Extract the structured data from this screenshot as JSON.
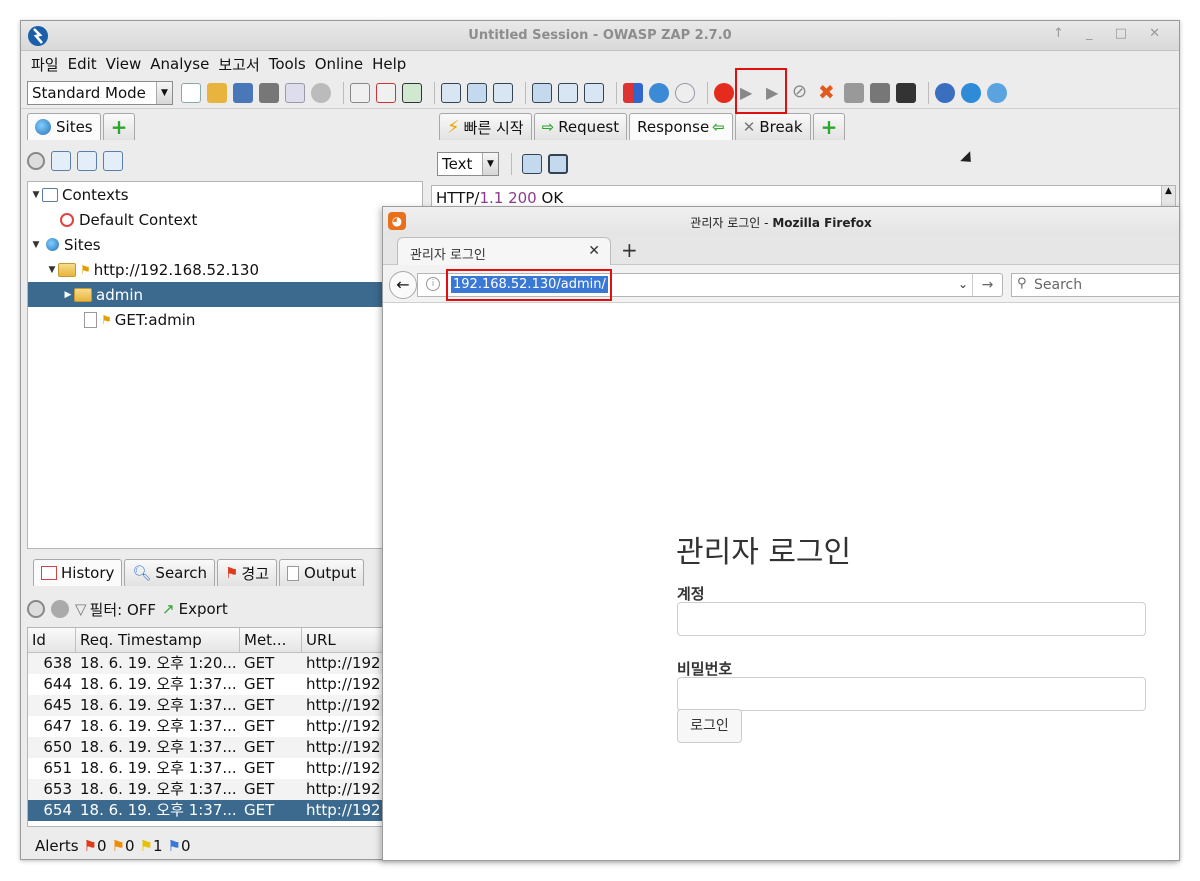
{
  "zap": {
    "title": "Untitled Session - OWASP ZAP 2.7.0",
    "window_controls": "↑ _ □ ✕",
    "menu": [
      "파일",
      "Edit",
      "View",
      "Analyse",
      "보고서",
      "Tools",
      "Online",
      "Help"
    ],
    "mode": "Standard Mode",
    "left_tabs": {
      "sites": "Sites"
    },
    "right_tabs": {
      "quick_start": "빠른 시작",
      "request": "Request",
      "response": "Response",
      "break": "Break"
    },
    "response_view": {
      "mode": "Text",
      "status_prefix": "HTTP/",
      "version": "1.1",
      "code": "200",
      "status_text": "OK"
    },
    "tree": {
      "contexts": "Contexts",
      "default_context": "Default Context",
      "sites": "Sites",
      "host": "http://192.168.52.130",
      "admin": "admin",
      "get_admin": "GET:admin"
    },
    "bottom_tabs": {
      "history": "History",
      "search": "Search",
      "alerts_tab": "경고",
      "output": "Output"
    },
    "filter": "필터: OFF",
    "export": "Export",
    "history_columns": [
      "Id",
      "Req. Timestamp",
      "Met...",
      "URL"
    ],
    "history_rows": [
      {
        "id": "638",
        "ts": "18. 6. 19. 오후 1:20...",
        "method": "GET",
        "url": "http://192."
      },
      {
        "id": "644",
        "ts": "18. 6. 19. 오후 1:37...",
        "method": "GET",
        "url": "http://192."
      },
      {
        "id": "645",
        "ts": "18. 6. 19. 오후 1:37...",
        "method": "GET",
        "url": "http://192."
      },
      {
        "id": "647",
        "ts": "18. 6. 19. 오후 1:37...",
        "method": "GET",
        "url": "http://192."
      },
      {
        "id": "650",
        "ts": "18. 6. 19. 오후 1:37...",
        "method": "GET",
        "url": "http://192."
      },
      {
        "id": "651",
        "ts": "18. 6. 19. 오후 1:37...",
        "method": "GET",
        "url": "http://192."
      },
      {
        "id": "653",
        "ts": "18. 6. 19. 오후 1:37...",
        "method": "GET",
        "url": "http://192."
      },
      {
        "id": "654",
        "ts": "18. 6. 19. 오후 1:37...",
        "method": "GET",
        "url": "http://192."
      }
    ],
    "status": {
      "label": "Alerts",
      "high": "0",
      "medium": "0",
      "low": "1",
      "info": "0"
    }
  },
  "firefox": {
    "title_page": "관리자 로그인",
    "title_app": "Mozilla Firefox",
    "tab_title": "관리자 로그인",
    "url": "192.168.52.130/admin/",
    "search_placeholder": "Search",
    "page": {
      "heading": "관리자 로그인",
      "account_label": "계정",
      "password_label": "비밀번호",
      "login_button": "로그인"
    }
  },
  "colors": {
    "selection": "#3c6a8f",
    "annotation": "#e01010",
    "highlight": "#3a78d6"
  }
}
